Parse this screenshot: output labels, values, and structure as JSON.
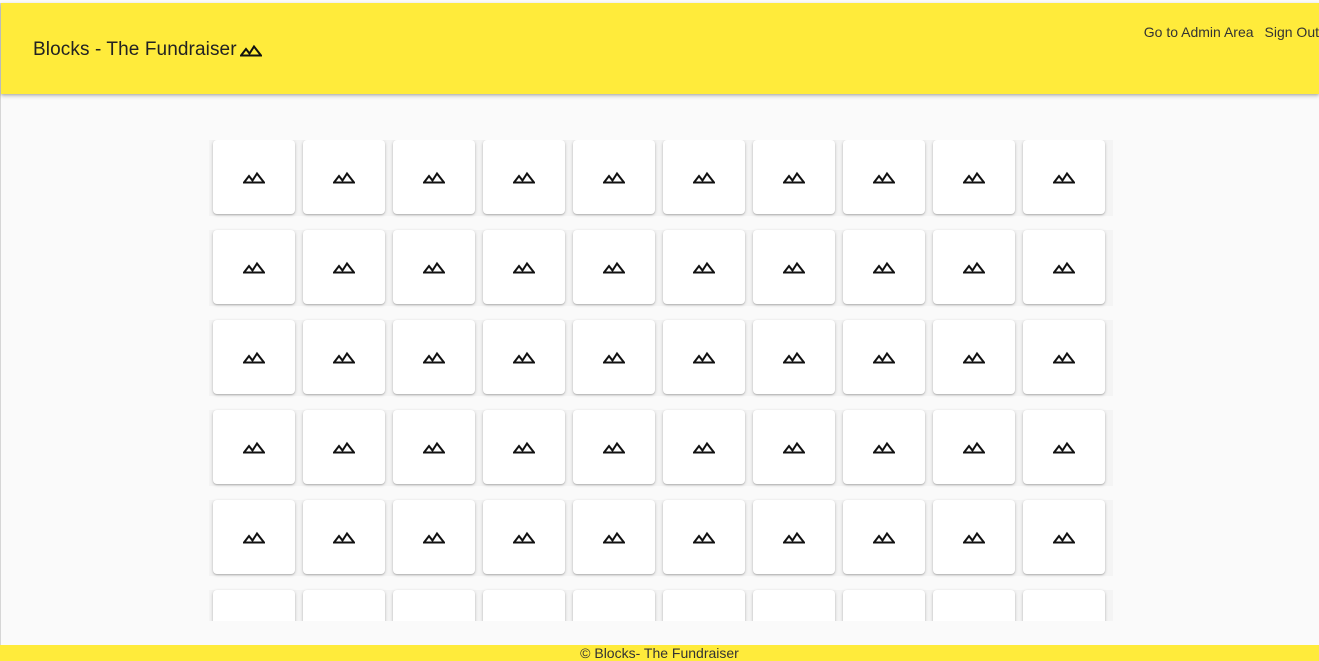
{
  "header": {
    "title": "Blocks - The Fundraiser",
    "icon": "landscape-icon",
    "background": "#ffeb3b"
  },
  "nav": {
    "admin_link": "Go to Admin Area",
    "signout_link": "Sign Out"
  },
  "grid": {
    "rows": 6,
    "columns": 10,
    "tile_icon": "landscape-icon"
  },
  "footer": {
    "text": "© Blocks- The Fundraiser"
  }
}
